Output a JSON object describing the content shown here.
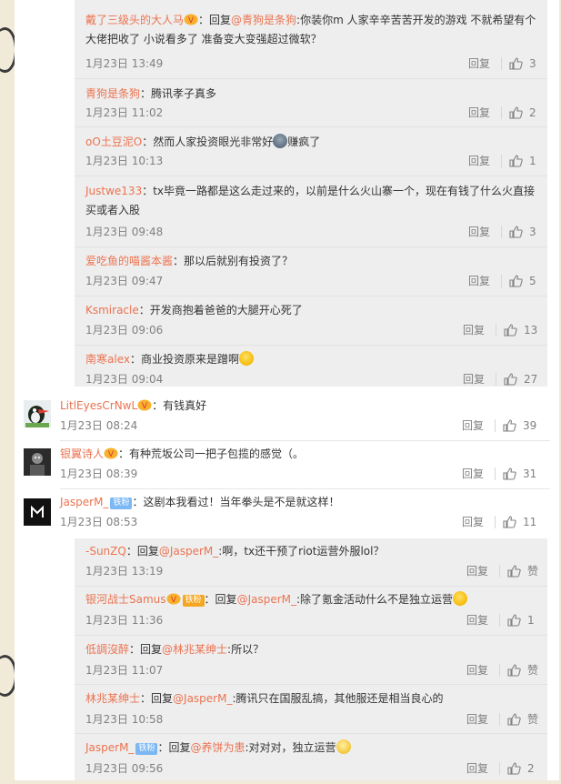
{
  "nested_replies_top": [
    {
      "name": "戴了三级头的大人马",
      "has_v_badge": true,
      "prefix": "：回复",
      "at_name": "@青狗是条狗",
      "body": ":你装你m 人家辛辛苦苦开发的游戏 不就希望有个大佬把收了 小说看多了 准备变大变强超过微软？",
      "time": "1月23日 13:49",
      "reply_label": "回复",
      "likes": "3"
    },
    {
      "name": "青狗是条狗",
      "body": "：腾讯孝子真多",
      "time": "1月23日 11:02",
      "reply_label": "回复",
      "likes": "2"
    },
    {
      "name": "oO土豆泥O",
      "body": "：然而人家投资眼光非常好",
      "body_after_emoji": "赚疯了",
      "time": "1月23日 10:13",
      "reply_label": "回复",
      "likes": "1"
    },
    {
      "name": "Justwe133",
      "body": "：tx毕竟一路都是这么走过来的，以前是什么火山寨一个，现在有钱了什么火直接买或者入股",
      "time": "1月23日 09:48",
      "reply_label": "回复",
      "likes": "3"
    },
    {
      "name": "爱吃鱼的喵酱本酱",
      "body": "：那以后就别有投资了？",
      "time": "1月23日 09:47",
      "reply_label": "回复",
      "likes": "5"
    },
    {
      "name": "Ksmiracle",
      "body": "：开发商抱着爸爸的大腿开心死了",
      "time": "1月23日 09:06",
      "reply_label": "回复",
      "likes": "13"
    },
    {
      "name": "南寒alex",
      "body": "：商业投资原来是蹭啊",
      "time": "1月23日 09:04",
      "reply_label": "回复",
      "likes": "27"
    }
  ],
  "top_comments": [
    {
      "name": "LitlEyesCrNwL",
      "has_v_badge": true,
      "body": "：有钱真好",
      "time": "1月23日 08:24",
      "reply_label": "回复",
      "likes": "39"
    },
    {
      "name": "银翼诗人",
      "has_v_badge": true,
      "body": "：有种荒坂公司一把子包揽的感觉（。",
      "time": "1月23日 08:39",
      "reply_label": "回复",
      "likes": "31"
    },
    {
      "name": "JasperM_",
      "fan_badge": "铁粉",
      "body": "：这剧本我看过！当年拳头是不是就这样！",
      "time": "1月23日 08:53",
      "reply_label": "回复",
      "likes": "11"
    }
  ],
  "nested_replies_bottom": [
    {
      "name": "-SunZQ",
      "prefix": "：回复",
      "at_name": "@JasperM_",
      "body": ":啊，tx还干预了riot运营外服lol？",
      "time": "1月23日 13:19",
      "reply_label": "回复",
      "likes": "赞"
    },
    {
      "name": "银河战士Samus",
      "fan_badge": "铁粉",
      "prefix": "：回复",
      "at_name": "@JasperM_",
      "body": ":除了氪金活动什么不是独立运营",
      "time": "1月23日 11:36",
      "reply_label": "回复",
      "likes": "1"
    },
    {
      "name": "低調沒醉",
      "prefix": "：回复",
      "at_name": "@林兆某绅士",
      "body": ":所以？",
      "time": "1月23日 11:07",
      "reply_label": "回复",
      "likes": "赞"
    },
    {
      "name": "林兆某绅士",
      "prefix": "：回复",
      "at_name": "@JasperM_",
      "body": ":腾讯只在国服乱搞，其他服还是相当良心的",
      "time": "1月23日 10:58",
      "reply_label": "回复",
      "likes": "赞"
    },
    {
      "name": "JasperM_",
      "fan_badge": "铁粉",
      "prefix": "：回复",
      "at_name": "@养饼为患",
      "body": ":对对对，独立运营",
      "time": "1月23日 09:56",
      "reply_label": "回复",
      "likes": "2"
    }
  ],
  "colors": {
    "username": "#eb7350",
    "meta": "#808080",
    "fan_badge": "#7cb8f3",
    "reply_bg": "#eeeeee"
  }
}
